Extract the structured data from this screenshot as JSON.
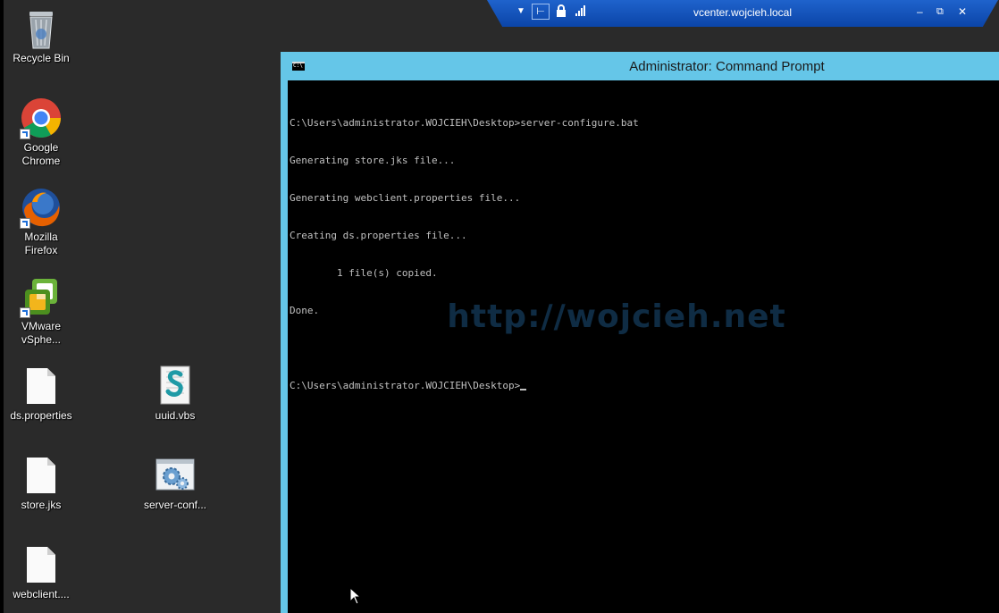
{
  "remote_bar": {
    "title": "vcenter.wojcieh.local",
    "minimize": "–",
    "restore": "⧉",
    "close": "✕"
  },
  "desktop": {
    "icons": [
      {
        "label": "Recycle Bin"
      },
      {
        "label": "Google Chrome"
      },
      {
        "label": "Mozilla Firefox"
      },
      {
        "label": "VMware vSphe..."
      },
      {
        "label": "ds.properties"
      },
      {
        "label": "uuid.vbs"
      },
      {
        "label": "store.jks"
      },
      {
        "label": "server-conf..."
      },
      {
        "label": "webclient...."
      }
    ]
  },
  "cmd": {
    "title": "Administrator: Command Prompt",
    "lines": [
      "C:\\Users\\administrator.WOJCIEH\\Desktop>server-configure.bat",
      "Generating store.jks file...",
      "Generating webclient.properties file...",
      "Creating ds.properties file...",
      "        1 file(s) copied.",
      "Done.",
      "",
      "C:\\Users\\administrator.WOJCIEH\\Desktop>"
    ],
    "watermark": "http://wojcieh.net"
  }
}
